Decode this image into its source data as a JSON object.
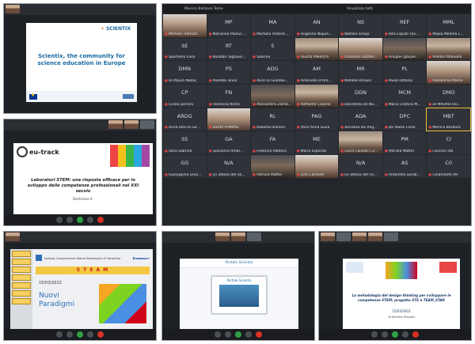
{
  "panel1": {
    "logo": "SCIENTIX",
    "title": "Scientix, the community for science education in Europe"
  },
  "panel2": {
    "logo": "eu-track",
    "title": "Laboratori STEM: una risposta efficace per lo sviluppo delle competenze professionali nel XXI secolo",
    "author": "Dochirena A."
  },
  "panel3": {
    "school": "Istituto Comprensivo Maria Montessori di Terracina",
    "erasmus": "Erasmus+",
    "banner": "S T E A M",
    "date": "15/03/2022",
    "heading_line1": "Nuovi",
    "heading_line2": "Paradigmi"
  },
  "panel4": {
    "header": "Portale Scientix",
    "card_title": "Portale Scientix"
  },
  "panel5": {
    "title": "La metodologia del design-thinking per sviluppare le competenze STEM: progetto STE e TEAM_STAR",
    "date": "15/03/2022",
    "author": "Di Michela Penzotti"
  },
  "gallery": {
    "host": "Monica Barbara Tome",
    "view": "Visualizza tutti",
    "tiles": [
      {
        "ini": "",
        "name": "Michela Tramizzi",
        "video": true,
        "style": "alt"
      },
      {
        "ini": "MP",
        "name": "Marianna Paoluc..."
      },
      {
        "ini": "MA",
        "name": "Martullo Antone..."
      },
      {
        "ini": "AN",
        "name": "Angelina Napoli..."
      },
      {
        "ini": "NS",
        "name": "Natalia Smajo"
      },
      {
        "ini": "REF",
        "name": "Rita Espido Fan..."
      },
      {
        "ini": "MML",
        "name": "Mojka Melena L..."
      },
      {
        "ini": "SE",
        "name": "Sportiello Elisa"
      },
      {
        "ini": "RT",
        "name": "Rosalba Tagliave..."
      },
      {
        "ini": "S",
        "name": "Sabrina"
      },
      {
        "ini": "",
        "name": "Fausta Palleschi",
        "video": true
      },
      {
        "ini": "",
        "name": "Graziella Gazzell...",
        "video": true,
        "style": "alt"
      },
      {
        "ini": "",
        "name": "Альден Доцан...",
        "video": true,
        "style": "dark"
      },
      {
        "ini": "",
        "name": "Polidori Manuela",
        "video": true
      },
      {
        "ini": "DMN",
        "name": "Di Mauro Nadia"
      },
      {
        "ini": "PS",
        "name": "Palombi silvia"
      },
      {
        "ini": "ADG",
        "name": "Alice Di Giambe..."
      },
      {
        "ini": "AM",
        "name": "Antonella D'Am..."
      },
      {
        "ini": "MR",
        "name": "Matilde RUSSO"
      },
      {
        "ini": "PL",
        "name": "Paola Iattanzi"
      },
      {
        "ini": "",
        "name": "Daniela Di Marce",
        "video": true,
        "style": "alt"
      },
      {
        "ini": "CP",
        "name": "Cinzia perroni"
      },
      {
        "ini": "FN",
        "name": "Filomena Nirchi"
      },
      {
        "ini": "",
        "name": "Alessandra Zamb...",
        "video": true,
        "style": "dark"
      },
      {
        "ini": "",
        "name": "Raffaella Caiaine",
        "video": true
      },
      {
        "ini": "DDN",
        "name": "Donatella De Na..."
      },
      {
        "ini": "MCM",
        "name": "Maria Cristina M..."
      },
      {
        "ini": "DMO",
        "name": "DI MAURO OLI..."
      },
      {
        "ini": "ARDG",
        "name": "Anna Rita Di Gir..."
      },
      {
        "ini": "",
        "name": "SILVIA POMPILI",
        "video": true,
        "style": "alt"
      },
      {
        "ini": "RL",
        "name": "Roberta Ieardini"
      },
      {
        "ini": "PAG",
        "name": "Paris Anna Gioia"
      },
      {
        "ini": "ADA",
        "name": "Annalisa De Ang..."
      },
      {
        "ini": "DPC",
        "name": "De Paolis Carlo"
      },
      {
        "ini": "MBT",
        "name": "Monica Barbara",
        "hl": true
      },
      {
        "ini": "SS",
        "name": "Silva Sabrina"
      },
      {
        "ini": "GA",
        "name": "Giovanna Amar..."
      },
      {
        "ini": "FA",
        "name": "Federica Addessi"
      },
      {
        "ini": "ME",
        "name": "Maria esposito"
      },
      {
        "ini": "",
        "name": "Lucia Caiazza C2...",
        "video": true
      },
      {
        "ini": "PM",
        "name": "Patrizia Mattei"
      },
      {
        "ini": "CI",
        "name": "Casconi ida"
      },
      {
        "ini": "GG",
        "name": "Giuseppina Gros..."
      },
      {
        "ini": "N/A",
        "name": "[in attesa del no..."
      },
      {
        "ini": "",
        "name": "Patrizia Mattei",
        "video": true,
        "style": "dark"
      },
      {
        "ini": "",
        "name": "Lina Camone",
        "video": true,
        "style": "alt"
      },
      {
        "ini": "N/A",
        "name": "[in attesa del no..."
      },
      {
        "ini": "AS",
        "name": "Antonella Sorab..."
      },
      {
        "ini": "C0",
        "name": "Chiamante 09"
      }
    ]
  }
}
